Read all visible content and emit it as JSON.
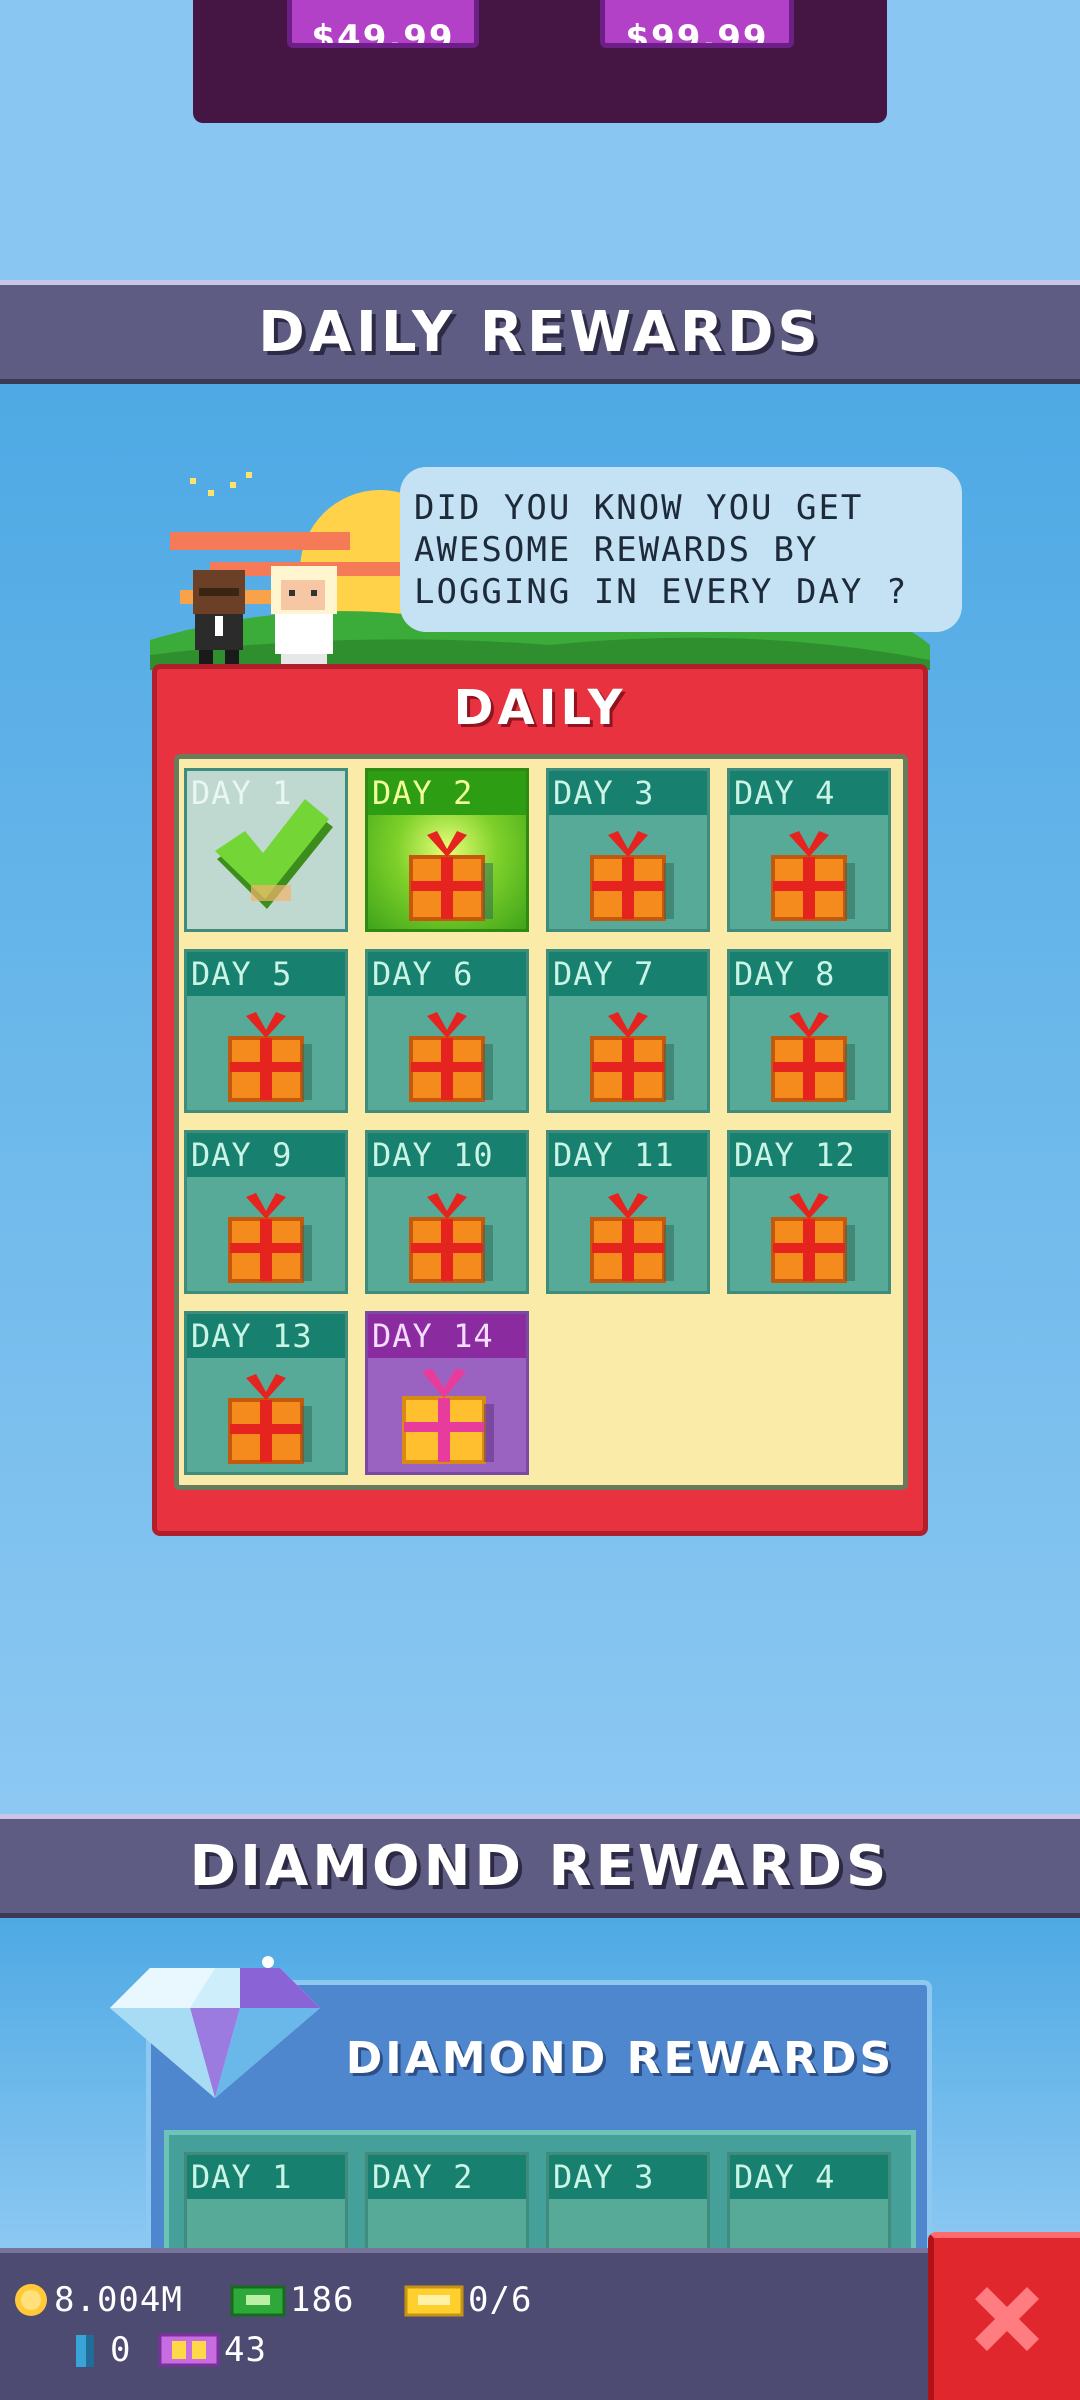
{
  "shop": {
    "price_left": "$49.99",
    "price_right": "$99.99"
  },
  "daily_section": {
    "header": "DAILY REWARDS",
    "tip": [
      "DID YOU KNOW YOU GET",
      "AWESOME REWARDS BY",
      "LOGGING IN EVERY DAY ?"
    ],
    "panel_title": "DAILY",
    "days": [
      {
        "label": "DAY 1",
        "state": "claimed",
        "icon": "checkmark-icon"
      },
      {
        "label": "DAY 2",
        "state": "current",
        "icon": "gift-icon"
      },
      {
        "label": "DAY 3",
        "state": "locked",
        "icon": "gift-icon"
      },
      {
        "label": "DAY 4",
        "state": "locked",
        "icon": "gift-icon"
      },
      {
        "label": "DAY 5",
        "state": "locked",
        "icon": "gift-icon"
      },
      {
        "label": "DAY 6",
        "state": "locked",
        "icon": "gift-icon"
      },
      {
        "label": "DAY 7",
        "state": "locked",
        "icon": "gift-icon"
      },
      {
        "label": "DAY 8",
        "state": "locked",
        "icon": "gift-icon"
      },
      {
        "label": "DAY 9",
        "state": "locked",
        "icon": "gift-icon"
      },
      {
        "label": "DAY 10",
        "state": "locked",
        "icon": "gift-icon"
      },
      {
        "label": "DAY 11",
        "state": "locked",
        "icon": "gift-icon"
      },
      {
        "label": "DAY 12",
        "state": "locked",
        "icon": "gift-icon"
      },
      {
        "label": "DAY 13",
        "state": "locked",
        "icon": "gift-icon"
      },
      {
        "label": "DAY 14",
        "state": "grand",
        "icon": "big-gift-icon"
      }
    ]
  },
  "diamond_section": {
    "header": "DIAMOND REWARDS",
    "panel_title": "DIAMOND REWARDS",
    "days": [
      {
        "label": "DAY 1"
      },
      {
        "label": "DAY 2"
      },
      {
        "label": "DAY 3"
      },
      {
        "label": "DAY 4"
      }
    ]
  },
  "hud": {
    "coins": "8.004M",
    "cash": "186",
    "tickets": "0/6",
    "keys": "0",
    "tv": "43"
  },
  "colors": {
    "sky": "#8ac6f2",
    "header": "#5f5c83",
    "daily_frame": "#e9323f",
    "close": "#e0272d"
  }
}
